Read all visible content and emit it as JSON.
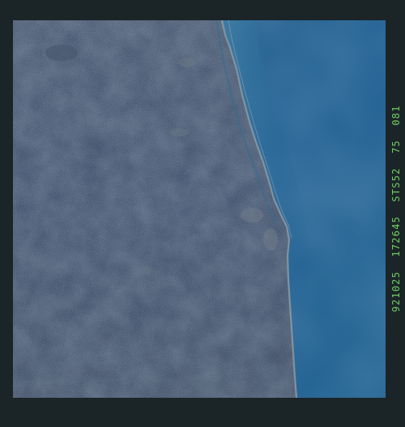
{
  "photo": {
    "frame_annotation": "921025 172645 STS52 75 081",
    "annotation_color": "#6fce62",
    "frame_color": "#1b2528",
    "land_color": "#2e3f5e",
    "ocean_color": "#1f5f92",
    "coast_color": "#8d9aa2"
  }
}
